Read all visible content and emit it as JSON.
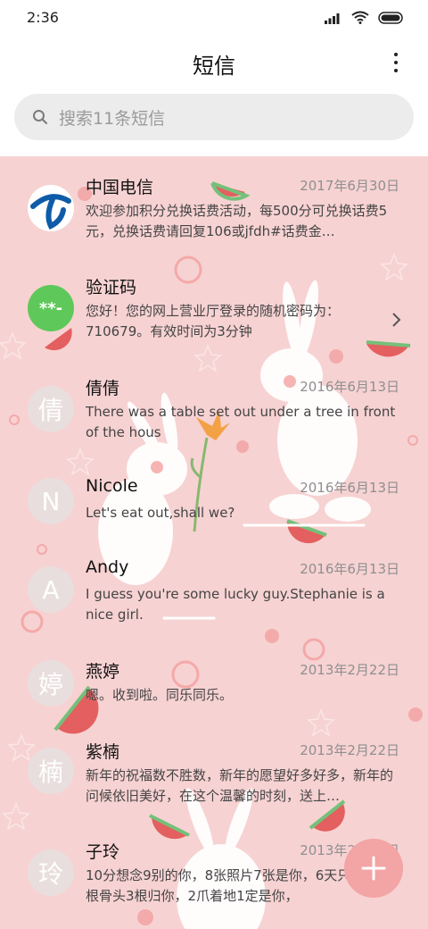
{
  "status_bar": {
    "time": "2:36",
    "icons": [
      "signal-icon",
      "wifi-icon",
      "battery-icon"
    ]
  },
  "header": {
    "title": "短信",
    "menu_icon": "more-vertical-icon"
  },
  "search": {
    "placeholder": "搜索11条短信",
    "icon": "search-icon"
  },
  "colors": {
    "background": "#f7d2d2",
    "avatar": "#e9dede",
    "fab": "#f3a4a4",
    "verify_avatar": "#5fc85a"
  },
  "messages": [
    {
      "sender": "中国电信",
      "date": "2017年6月30日",
      "preview": "欢迎参加积分兑换话费活动，每500分可兑换话费5元，兑换话费请回复106或jfdh#话费金…",
      "avatar": "china-telecom-logo"
    },
    {
      "sender": "验证码",
      "date": "",
      "preview": "您好！您的网上营业厅登录的随机密码为：710679。有效时间为3分钟",
      "avatar": "**-"
    },
    {
      "sender": "倩倩",
      "date": "2016年6月13日",
      "preview": "There was a table set out under a tree in front of the hous",
      "avatar": "倩"
    },
    {
      "sender": "Nicole",
      "date": "2016年6月13日",
      "preview": "Let's eat out,shall we?",
      "avatar": "N"
    },
    {
      "sender": "Andy",
      "date": "2016年6月13日",
      "preview": "I guess you're some lucky guy.Stephanie is a nice girl.",
      "avatar": "A"
    },
    {
      "sender": "燕婷",
      "date": "2013年2月22日",
      "preview": "嗯。收到啦。同乐同乐。",
      "avatar": "婷"
    },
    {
      "sender": "紫楠",
      "date": "2013年2月22日",
      "preview": "新年的祝福数不胜数，新年的愿望好多好多，新年的问候依旧美好，在这个温馨的时刻，送上…",
      "avatar": "楠"
    },
    {
      "sender": "子玲",
      "date": "2013年2月22日",
      "preview": "10分想念9别的你，8张照片7张是你，6天只像你，4根骨头3根归你，2爪着地1定是你，",
      "avatar": "玲"
    }
  ],
  "fab": {
    "icon": "plus-icon"
  }
}
